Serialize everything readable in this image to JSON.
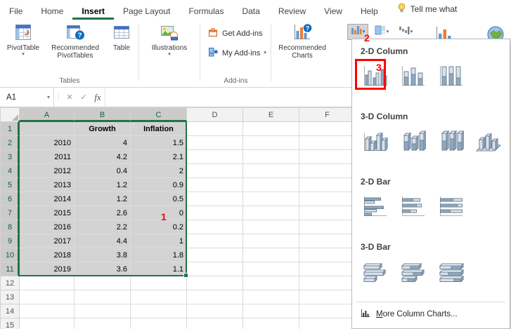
{
  "colors": {
    "accent_green": "#217346",
    "annotation_red": "#ff0000",
    "selection_fill": "#d3d3d3",
    "grid_line": "#dcdcdc"
  },
  "tabs": [
    {
      "label": "File",
      "active": false
    },
    {
      "label": "Home",
      "active": false
    },
    {
      "label": "Insert",
      "active": true
    },
    {
      "label": "Page Layout",
      "active": false
    },
    {
      "label": "Formulas",
      "active": false
    },
    {
      "label": "Data",
      "active": false
    },
    {
      "label": "Review",
      "active": false
    },
    {
      "label": "View",
      "active": false
    },
    {
      "label": "Help",
      "active": false
    }
  ],
  "tell_me": {
    "label": "Tell me what"
  },
  "ribbon": {
    "tables_group": {
      "label": "Tables",
      "pivottable": "PivotTable",
      "recommended_pivottables": "Recommended PivotTables",
      "table": "Table"
    },
    "illustrations_group": {
      "illustrations": "Illustrations"
    },
    "addins_group": {
      "label": "Add-ins",
      "get_addins": "Get Add-ins",
      "my_addins": "My Add-ins"
    },
    "charts_group": {
      "recommended_charts": "Recommended Charts"
    }
  },
  "formula_bar": {
    "name_box": "A1",
    "fx_label": "fx",
    "formula": ""
  },
  "sheet": {
    "col_headers": [
      "A",
      "B",
      "C",
      "D",
      "E",
      "F"
    ],
    "row_count": 15,
    "header_row": {
      "b": "Growth",
      "c": "Inflation"
    },
    "data_rows": [
      [
        "2010",
        "4",
        "1.5"
      ],
      [
        "2011",
        "4.2",
        "2.1"
      ],
      [
        "2012",
        "0.4",
        "2"
      ],
      [
        "2013",
        "1.2",
        "0.9"
      ],
      [
        "2014",
        "1.2",
        "0.5"
      ],
      [
        "2015",
        "2.6",
        "0"
      ],
      [
        "2016",
        "2.2",
        "0.2"
      ],
      [
        "2017",
        "4.4",
        "1"
      ],
      [
        "2018",
        "3.8",
        "1.8"
      ],
      [
        "2019",
        "3.6",
        "1.1"
      ]
    ],
    "selection": {
      "range": "A1:C11",
      "selected_cols": 3,
      "selected_rows": 11
    }
  },
  "chart_menu": {
    "sections": [
      {
        "title": "2-D Column",
        "icons": [
          "clustered-column",
          "stacked-column",
          "stacked-column-100"
        ]
      },
      {
        "title": "3-D Column",
        "icons": [
          "clustered-column-3d",
          "stacked-column-3d",
          "stacked-column-100-3d",
          "column-3d"
        ]
      },
      {
        "title": "2-D Bar",
        "icons": [
          "clustered-bar",
          "stacked-bar",
          "stacked-bar-100"
        ]
      },
      {
        "title": "3-D Bar",
        "icons": [
          "clustered-bar-3d",
          "stacked-bar-3d",
          "stacked-bar-100-3d"
        ]
      }
    ],
    "footer": "More Column Charts..."
  },
  "annotations": {
    "step1": "1",
    "step2": "2",
    "step3": "3"
  }
}
